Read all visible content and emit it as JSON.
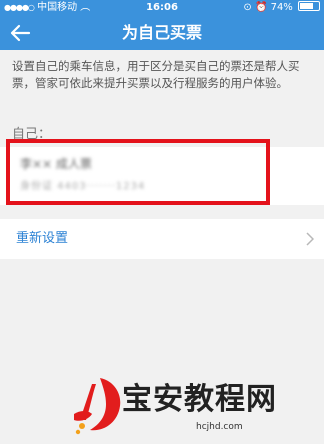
{
  "status_bar": {
    "carrier": "中国移动",
    "time": "16:06",
    "battery_text": "74%",
    "battery_level": 0.74
  },
  "nav": {
    "title": "为自己买票",
    "back_icon": "arrow-left-icon"
  },
  "description": "设置自己的乘车信息，用于区分是买自己的票还是帮人买票，管家可依此来提升买票以及行程服务的用户体验。",
  "self_section": {
    "label": "自己：",
    "name_blurred": "李××  成人票",
    "id_blurred": "身份证 4403·······1234"
  },
  "reset_row": {
    "label": "重新设置",
    "chevron_icon": "chevron-right-icon"
  },
  "watermark": {
    "text": "宝安教程网",
    "url": "hcjhd.com"
  },
  "colors": {
    "header_blue": "#3b92dc",
    "highlight_red": "#e4121b",
    "link_blue": "#2c82d4"
  }
}
